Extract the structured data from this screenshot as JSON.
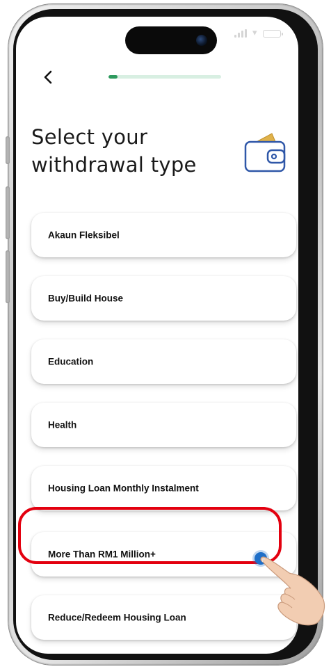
{
  "screen": {
    "title_line1": "Select your",
    "title_line2": "withdrawal type",
    "progress_fraction": 0.08
  },
  "icons": {
    "back": "chevron-left-icon",
    "wallet": "wallet-icon",
    "pointer": "hand-pointer-icon"
  },
  "options": [
    {
      "label": "Akaun Fleksibel"
    },
    {
      "label": "Buy/Build House"
    },
    {
      "label": "Education"
    },
    {
      "label": "Health"
    },
    {
      "label": "Housing Loan Monthly Instalment"
    },
    {
      "label": "More Than RM1 Million+",
      "highlighted": true
    },
    {
      "label": "Reduce/Redeem Housing Loan"
    }
  ],
  "colors": {
    "accent_green": "#2e9a5e",
    "highlight_red": "#e3000f",
    "tap_blue": "#1f6fc8",
    "wallet_blue": "#2f57a8",
    "wallet_card": "#e0b24a"
  }
}
